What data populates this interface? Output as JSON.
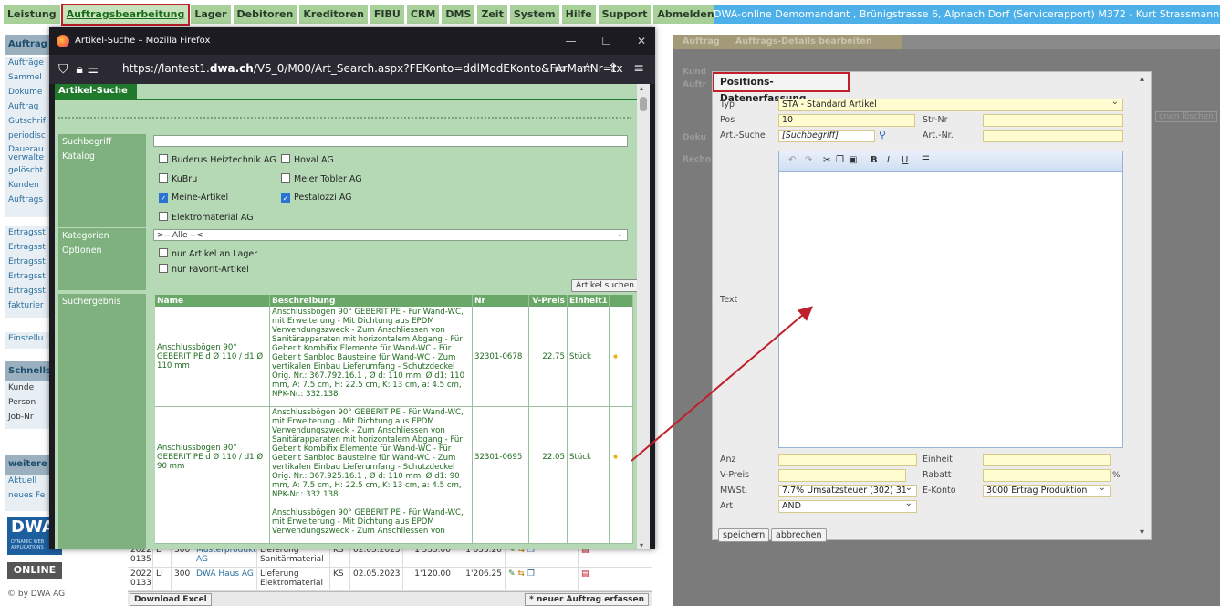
{
  "menu": {
    "items": [
      "Leistung",
      "Auftragsbearbeitung",
      "Lager",
      "Debitoren",
      "Kreditoren",
      "FIBU",
      "CRM",
      "DMS",
      "Zeit",
      "System",
      "Hilfe",
      "Support",
      "Abmelden"
    ],
    "active_index": 1
  },
  "infobar": "DWA-online Demomandant , Brünigstrasse 6, Alpnach Dorf (Servicerapport) M372 - Kurt Strassmann",
  "sidebar": {
    "section1_title": "Auftrag",
    "section1_items": [
      "Aufträge",
      "Sammel",
      "Dokume",
      "Auftrag",
      "Gutschrif",
      "periodisc",
      "Dauerau verwalte",
      "gelöscht",
      "Kunden",
      "Auftrags"
    ],
    "section2_items": [
      "Ertragsst",
      "Ertragsst",
      "Ertragsst",
      "Ertragsst",
      "Ertragsst",
      "fakturier"
    ],
    "settings_item": "Einstellu",
    "section3_title": "Schnells",
    "section3_items": [
      "Kunde",
      "Person",
      "Job-Nr"
    ],
    "section4_title": "weitere",
    "section4_items": [
      "Aktuell",
      "neues Fe"
    ],
    "logo_text": "DWA",
    "logo_sub": "DYNAMIC WEB APPLICATIONS",
    "online_badge": "ONLINE",
    "copyright": "© by DWA AG"
  },
  "firefox": {
    "window_title": "Artikel-Suche – Mozilla Firefox",
    "url_prefix": "https://lantest1.",
    "url_domain": "dwa.ch",
    "url_suffix": "/V5_0/M00/Art_Search.aspx?FEKonto=ddlModEKonto&FArManNr=tx"
  },
  "search": {
    "tab_title": "Artikel-Suche",
    "label_suchbegriff": "Suchbegriff",
    "label_katalog": "Katalog",
    "catalogs": [
      {
        "label": "Buderus Heiztechnik AG",
        "checked": false
      },
      {
        "label": "Hoval AG",
        "checked": false
      },
      {
        "label": "KuBru",
        "checked": false
      },
      {
        "label": "Meier Tobler AG",
        "checked": false
      },
      {
        "label": "Meine-Artikel",
        "checked": true
      },
      {
        "label": "Pestalozzi AG",
        "checked": true
      },
      {
        "label": "Elektromaterial AG",
        "checked": false
      }
    ],
    "label_kategorien": "Kategorien",
    "kategorien_value": ">-- Alle --<",
    "label_optionen": "Optionen",
    "option_lager": "nur Artikel an Lager",
    "option_favorit": "nur Favorit-Artikel",
    "search_button": "Artikel suchen",
    "label_ergebnis": "Suchergebnis",
    "columns": [
      "Name",
      "Beschreibung",
      "Nr",
      "V-Preis",
      "Einheit1",
      ""
    ],
    "rows": [
      {
        "name": "Anschlussbögen 90° GEBERIT PE d Ø 110 / d1 Ø 110 mm",
        "desc": "Anschlussbögen 90° GEBERIT PE - Für Wand-WC, mit Erweiterung - Mit Dichtung aus EPDM Verwendungszweck - Zum Anschliessen von Sanitärapparaten mit horizontalem Abgang - Für Geberit Kombifix Elemente für Wand-WC - Für Geberit Sanbloc Bausteine für Wand-WC - Zum vertikalen Einbau Lieferumfang - Schutzdeckel Orig. Nr.: 367.792.16.1 , Ø d: 110 mm, Ø d1: 110 mm, A: 7.5 cm, H: 22.5 cm, K: 13 cm, a: 4.5 cm, NPK-Nr.: 332.138",
        "nr": "32301-0678",
        "price": "22.75",
        "unit": "Stück"
      },
      {
        "name": "Anschlussbögen 90° GEBERIT PE d Ø 110 / d1 Ø 90 mm",
        "desc": "Anschlussbögen 90° GEBERIT PE - Für Wand-WC, mit Erweiterung - Mit Dichtung aus EPDM Verwendungszweck - Zum Anschliessen von Sanitärapparaten mit horizontalem Abgang - Für Geberit Kombifix Elemente für Wand-WC - Für Geberit Sanbloc Bausteine für Wand-WC - Zum vertikalen Einbau Lieferumfang - Schutzdeckel Orig. Nr.: 367.925.16.1 , Ø d: 110 mm, Ø d1: 90 mm, A: 7.5 cm, H: 22.5 cm, K: 13 cm, a: 4.5 cm, NPK-Nr.: 332.138",
        "nr": "32301-0695",
        "price": "22.05",
        "unit": "Stück"
      },
      {
        "name": "",
        "desc": "Anschlussbögen 90° GEBERIT PE - Für Wand-WC, mit Erweiterung - Mit Dichtung aus EPDM Verwendungszweck - Zum Anschliessen von",
        "nr": "",
        "price": "",
        "unit": ""
      }
    ]
  },
  "bg_table": {
    "rows": [
      {
        "year": "2022 0135",
        "type": "LI",
        "num": "300",
        "customer": "Musterprodukte AG",
        "desc": "Lieferung Sanitärmaterial",
        "ks": "KS",
        "date": "02.05.2023",
        "a1": "1'535.00",
        "a2": "1'653.20"
      },
      {
        "year": "2022 0133",
        "type": "LI",
        "num": "300",
        "customer": "DWA Haus AG",
        "desc": "Lieferung Elektromaterial",
        "ks": "KS",
        "date": "02.05.2023",
        "a1": "1'120.00",
        "a2": "1'206.25"
      }
    ],
    "download_button": "Download Excel",
    "new_order_button": "* neuer Auftrag erfassen"
  },
  "right_bg": {
    "tab1": "Auftrag",
    "tab2": "Auftrags-Details bearbeiten",
    "dim_labels": [
      "Kund",
      "Auftr",
      "Doku",
      "Rechn"
    ],
    "dim_button": "onen löschen"
  },
  "dialog": {
    "title": "Positions-Datenerfassung",
    "label_typ": "Typ",
    "typ_value": "STA - Standard Artikel",
    "label_pos": "Pos",
    "pos_value": "10",
    "label_strnr": "Str-Nr",
    "strnr_value": "",
    "label_artsuche": "Art.-Suche",
    "artsuche_placeholder": "[Suchbegriff]",
    "label_artnr": "Art.-Nr.",
    "artnr_value": "",
    "label_text": "Text",
    "label_anz": "Anz",
    "label_einheit": "Einheit",
    "label_vpreis": "V-Preis",
    "label_rabatt": "Rabatt",
    "rabatt_unit": "%",
    "label_mwst": "MWSt.",
    "mwst_value": "7.7% Umsatzsteuer (302) 31",
    "label_ekonto": "E-Konto",
    "ekonto_value": "3000 Ertrag Produktion",
    "label_art": "Art",
    "art_value": "AND",
    "save_button": "speichern",
    "cancel_button": "abbrechen"
  },
  "colors": {
    "menu_green": "#a8d19a",
    "highlight_red": "#c0202a",
    "popup_green": "#b5d9b5",
    "header_green": "#1f7a2c",
    "infobar_blue": "#4db0e8"
  }
}
